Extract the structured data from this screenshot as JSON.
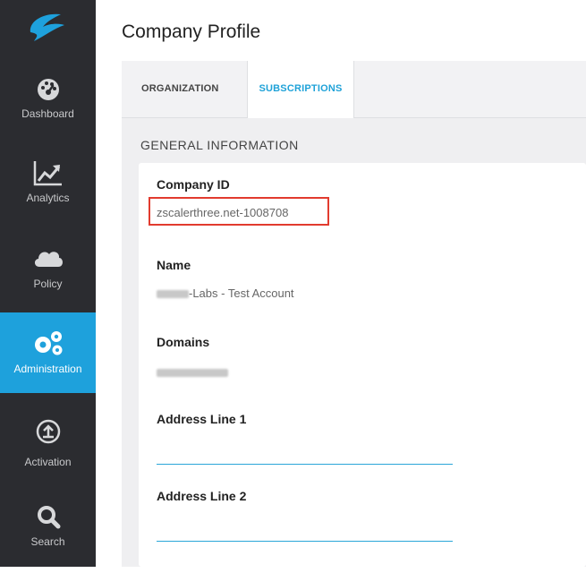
{
  "sidebar": {
    "items": [
      {
        "label": "Dashboard",
        "icon": "gauge-icon"
      },
      {
        "label": "Analytics",
        "icon": "chart-icon"
      },
      {
        "label": "Policy",
        "icon": "cloud-icon"
      },
      {
        "label": "Administration",
        "icon": "gears-icon"
      },
      {
        "label": "Activation",
        "icon": "upload-icon"
      },
      {
        "label": "Search",
        "icon": "search-icon"
      }
    ],
    "active": "Administration"
  },
  "page": {
    "title": "Company Profile"
  },
  "tabs": [
    {
      "label": "ORGANIZATION"
    },
    {
      "label": "SUBSCRIPTIONS",
      "selected": true
    }
  ],
  "section": {
    "heading": "GENERAL INFORMATION"
  },
  "fields": {
    "company_id": {
      "label": "Company ID",
      "value": "zscalerthree.net-1008708"
    },
    "name": {
      "label": "Name",
      "value_suffix": "-Labs - Test Account"
    },
    "domains": {
      "label": "Domains"
    },
    "address1": {
      "label": "Address Line 1",
      "value": ""
    },
    "address2": {
      "label": "Address Line 2",
      "value": ""
    }
  },
  "colors": {
    "sidebar_bg": "#2b2c30",
    "active_bg": "#1ea1dc",
    "accent": "#1fa2d8",
    "highlight_box": "#e23b2f"
  }
}
